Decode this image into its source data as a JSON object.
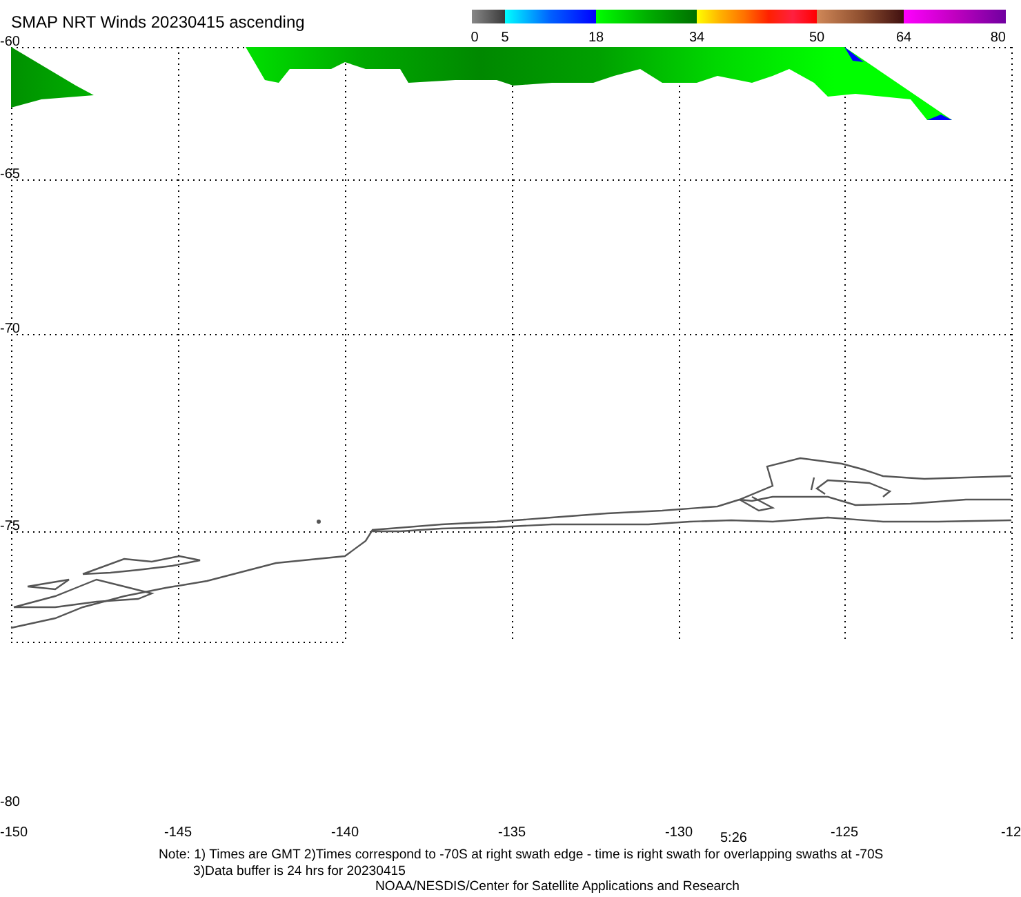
{
  "title": "SMAP NRT Winds 20230415 ascending",
  "color_bar": {
    "ticks": [
      "0",
      "5",
      "18",
      "34",
      "50",
      "64",
      "80"
    ]
  },
  "lat_labels": [
    "-60",
    "-65",
    "-70",
    "-75",
    "-80"
  ],
  "lon_labels": [
    "-150",
    "-145",
    "-140",
    "-135",
    "-130",
    "-125",
    "-12"
  ],
  "time_label": "5:26",
  "notes": [
    "Note: 1) Times are GMT 2)Times correspond to -70S at right swath edge - time is right swath for overlapping swaths at -70S",
    "3)Data buffer is 24 hrs for 20230415"
  ],
  "credit": "NOAA/NESDIS/Center for Satellite Applications and Research"
}
